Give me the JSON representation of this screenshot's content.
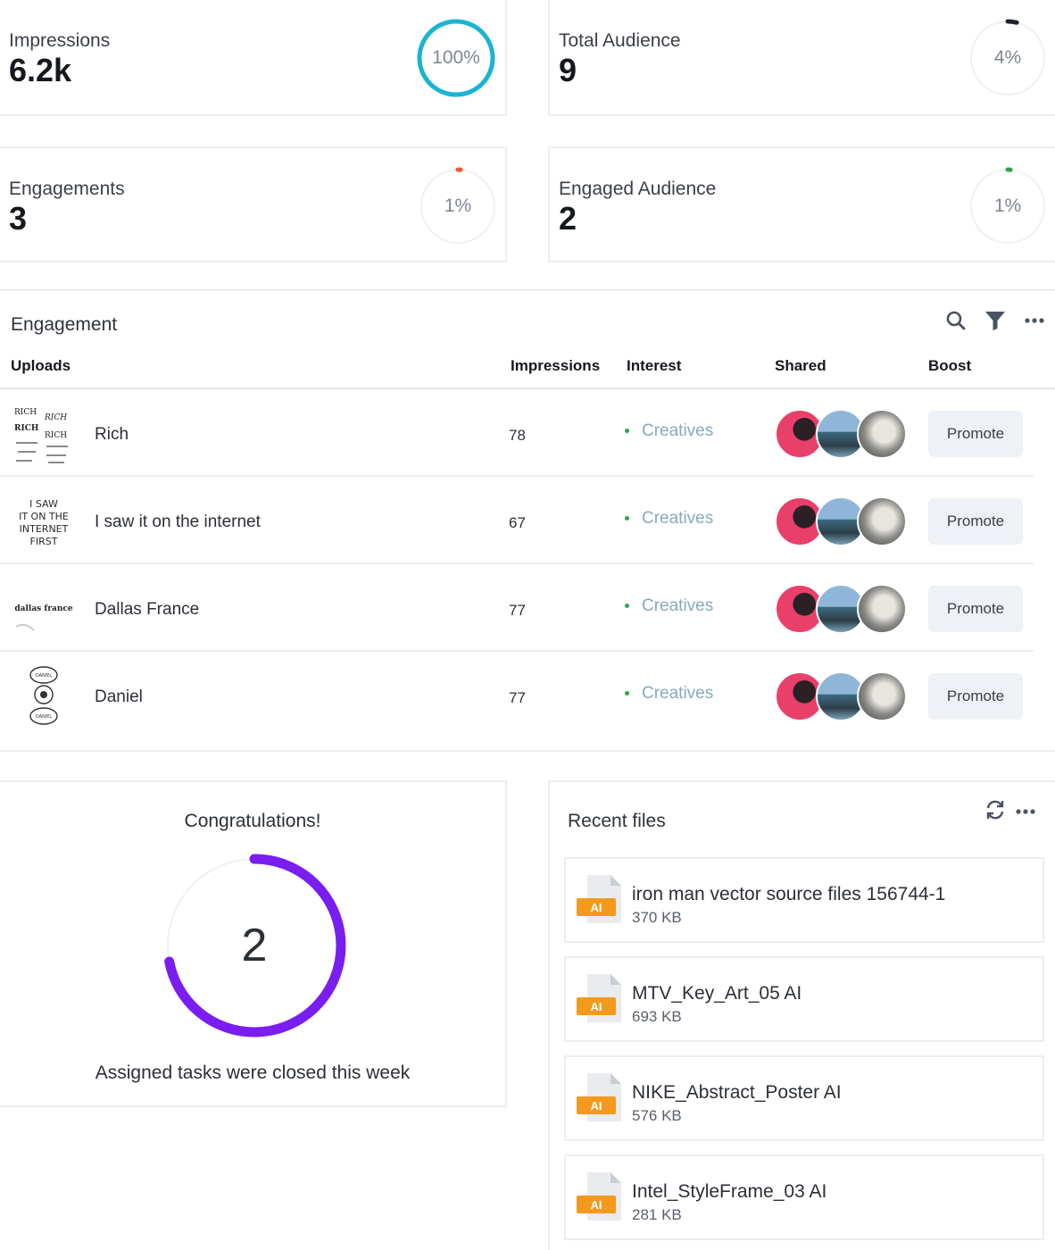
{
  "stats": [
    {
      "label": "Impressions",
      "value": "6.2k",
      "percent_label": "100%",
      "percent": 100,
      "ring_color": "#1ab4d3"
    },
    {
      "label": "Total Audience",
      "value": "9",
      "percent_label": "4%",
      "percent": 4,
      "ring_color": "#1f2430"
    },
    {
      "label": "Engagements",
      "value": "3",
      "percent_label": "1%",
      "percent": 1,
      "ring_color": "#f25a2a"
    },
    {
      "label": "Engaged Audience",
      "value": "2",
      "percent_label": "1%",
      "percent": 1,
      "ring_color": "#2ea54a"
    }
  ],
  "engagement": {
    "title": "Engagement",
    "columns": {
      "uploads": "Uploads",
      "impressions": "Impressions",
      "interest": "Interest",
      "shared": "Shared",
      "boost": "Boost"
    },
    "rows": [
      {
        "name": "Rich",
        "impressions": "78",
        "interest": "Creatives",
        "boost": "Promote"
      },
      {
        "name": "I saw it on the internet",
        "impressions": "67",
        "interest": "Creatives",
        "boost": "Promote"
      },
      {
        "name": "Dallas France",
        "impressions": "77",
        "interest": "Creatives",
        "boost": "Promote"
      },
      {
        "name": "Daniel",
        "impressions": "77",
        "interest": "Creatives",
        "boost": "Promote"
      }
    ],
    "thumb_text": {
      "rich": [
        "RICH",
        "RICH",
        "RICH",
        "RICH"
      ],
      "internet": [
        "I SAW",
        "IT ON THE",
        "INTERNET",
        "FIRST"
      ],
      "dallas": "dallas france",
      "daniel": [
        "DANIEL",
        "DANIEL"
      ]
    }
  },
  "congrats": {
    "title": "Congratulations!",
    "count": "2",
    "progress": 0.72,
    "ring_color": "#7a1df0",
    "subtitle": "Assigned tasks were closed this week"
  },
  "recent_files": {
    "title": "Recent files",
    "badge": "AI",
    "files": [
      {
        "name": "iron man vector source files 156744-1",
        "size": "370 KB"
      },
      {
        "name": "MTV_Key_Art_05 AI",
        "size": "693 KB"
      },
      {
        "name": "NIKE_Abstract_Poster AI",
        "size": "576 KB"
      },
      {
        "name": "Intel_StyleFrame_03 AI",
        "size": "281 KB"
      }
    ]
  },
  "icons": {
    "search": "search-icon",
    "filter": "filter-icon",
    "more": "more-icon",
    "refresh": "refresh-icon"
  }
}
